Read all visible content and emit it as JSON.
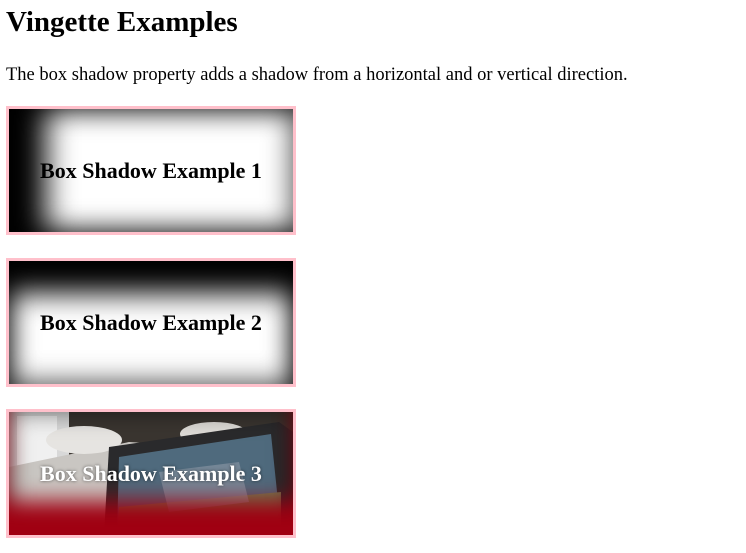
{
  "page": {
    "title": "Vingette Examples",
    "description": "The box shadow property adds a shadow from a horizontal and or vertical direction."
  },
  "boxes": [
    {
      "label": "Box Shadow Example 1"
    },
    {
      "label": "Box Shadow Example 2"
    },
    {
      "label": "Box Shadow Example 3"
    }
  ],
  "colors": {
    "border": "#ffc0cb",
    "shadow_dark": "#000000",
    "shadow_red": "#a00012"
  }
}
